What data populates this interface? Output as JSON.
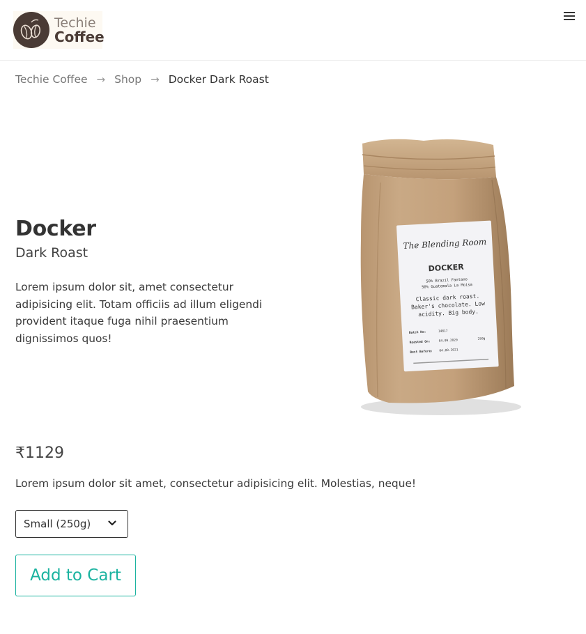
{
  "header": {
    "logo_line1": "Techie",
    "logo_line2": "Coffee",
    "menu_icon": "hamburger-icon"
  },
  "breadcrumb": [
    {
      "label": "Techie Coffee"
    },
    {
      "label": "Shop"
    },
    {
      "label": "Docker Dark Roast"
    }
  ],
  "breadcrumb_separator": "→",
  "product": {
    "name": "Docker",
    "subtitle": "Dark Roast",
    "description": "Lorem ipsum dolor sit, amet consectetur adipisicing elit. Totam officiis ad illum eligendi provident itaque fuga nihil praesentium dignissimos quos!",
    "price": "₹1129",
    "short_description": "Lorem ipsum dolor sit amet, consectetur adipisicing elit. Molestias, neque!",
    "size_selected": "Small (250g)",
    "add_to_cart_label": "Add to Cart",
    "image_label": {
      "brand_script": "The Blending Room",
      "name": "DOCKER",
      "blend_line1": "50% Brazil Fantano",
      "blend_line2": "50% Guatemala La Moisa",
      "notes_line1": "Classic dark roast.",
      "notes_line2": "Baker's chocolate. Low",
      "notes_line3": "acidity. Big body.",
      "batch_label": "Batch No:",
      "batch_value": "14817",
      "roasted_label": "Roasted On:",
      "roasted_value": "04.09.2020",
      "weight_value": "250g",
      "best_label": "Best Before:",
      "best_value": "04.09.2021"
    }
  },
  "colors": {
    "accent": "#1bb3a0",
    "logo_dark": "#4a3b35",
    "text": "#333333",
    "muted": "#777777"
  }
}
